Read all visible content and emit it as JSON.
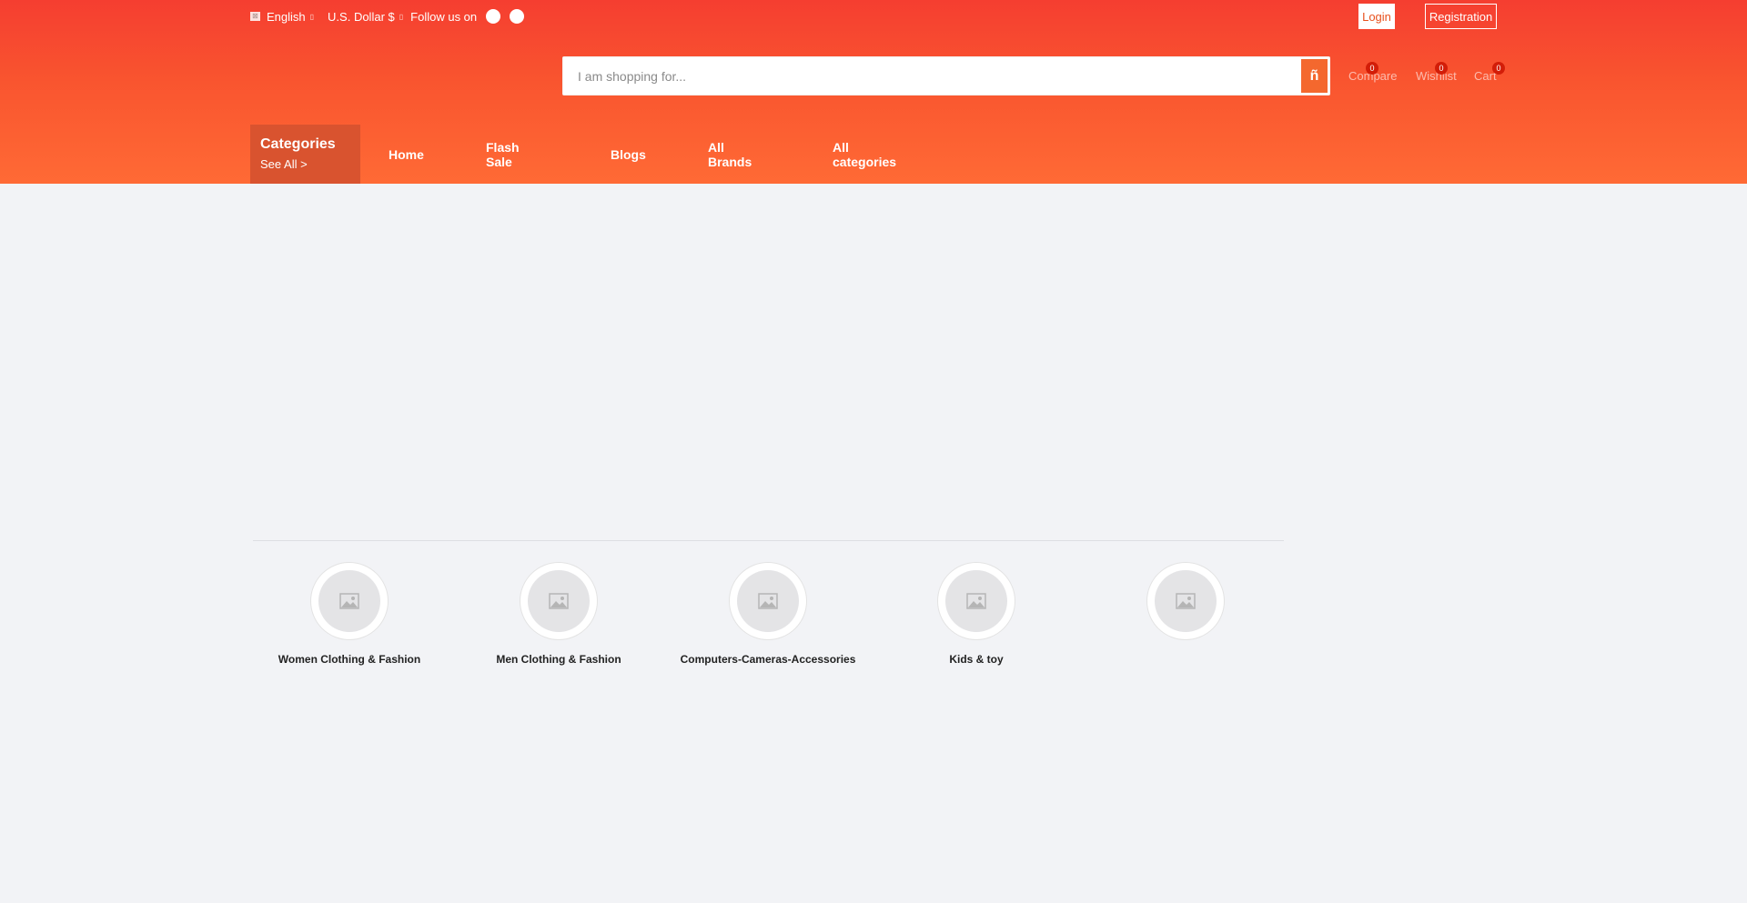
{
  "topbar": {
    "language": "English",
    "currency": "U.S. Dollar $",
    "follow_text": "Follow us on",
    "caret_icon": "chevron-down-icon",
    "social_icons": [
      "facebook-icon",
      "twitter-icon"
    ]
  },
  "auth": {
    "login_label": "Login",
    "register_label": "Registration"
  },
  "search": {
    "placeholder": "I am shopping for...",
    "button_glyph": "ñ"
  },
  "header_links": [
    {
      "label": "Compare",
      "count": "0"
    },
    {
      "label": "Wishlist",
      "count": "0"
    },
    {
      "label": "Cart",
      "count": "0"
    }
  ],
  "categories_menu": {
    "title": "Categories",
    "see_all": "See All >"
  },
  "nav": [
    "Home",
    "Flash Sale",
    "Blogs",
    "All Brands",
    "All categories"
  ],
  "featured_categories": [
    {
      "label": "Women Clothing & Fashion",
      "icon": "image-placeholder-icon"
    },
    {
      "label": "Men Clothing & Fashion",
      "icon": "image-placeholder-icon"
    },
    {
      "label": "Computers-Cameras-Accessories",
      "icon": "image-placeholder-icon"
    },
    {
      "label": "Kids & toy",
      "icon": "image-placeholder-icon"
    },
    {
      "label": "",
      "icon": "image-placeholder-icon"
    }
  ],
  "colors": {
    "header_top": "#f53e30",
    "header_bottom": "#ff6a35",
    "categories_bg": "#d9532f",
    "badge": "#d31d08",
    "page_bg": "#f2f3f6"
  }
}
